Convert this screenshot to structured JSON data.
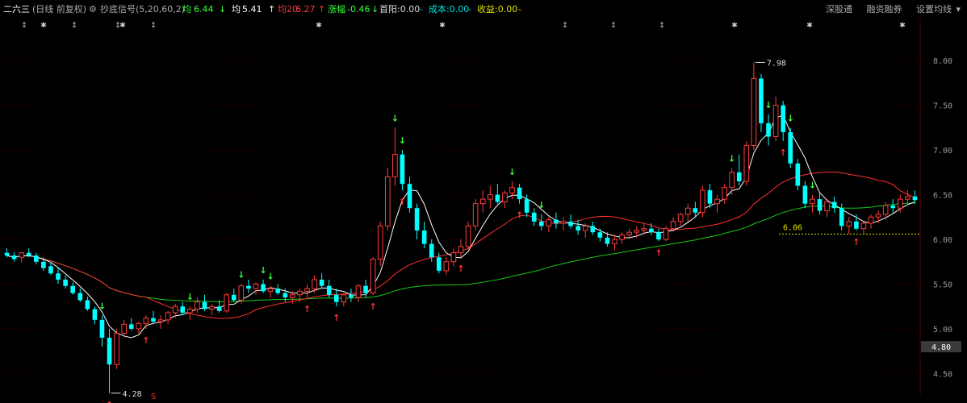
{
  "header": {
    "stock_name": "二六三",
    "period": "(日线 前复权)",
    "indicator": "抄底信号(5,20,60,2)",
    "ma5": {
      "label": "均",
      "value": "6.44",
      "arrow": "↓",
      "color": "#3cff3c"
    },
    "ma_a": {
      "label": "均",
      "value": "5.41",
      "arrow": "↑",
      "color": "#ffffff"
    },
    "ma20": {
      "label": "均20:",
      "value": "6.27",
      "arrow": "↑",
      "color": "#ff3b3b"
    },
    "change": {
      "label": "涨幅",
      "value": "-0.46",
      "arrow": "↓",
      "color": "#3cff3c"
    },
    "first_yang": "首阳:0.00",
    "cost": "成本:0.00",
    "profit": "收益:0.00",
    "dash": "-"
  },
  "toolbar": {
    "shenzhen": "深股通",
    "margin": "融资融券",
    "ma_settings": "设置均线"
  },
  "annotations": {
    "high": "7.98",
    "low": "4.28",
    "level": "6.06",
    "s_mark": "S",
    "last_price": "4.80"
  },
  "colors": {
    "up": "#ff3b3b",
    "down": "#00ffff",
    "ma5": "#ffffff",
    "ma20": "#ff3030",
    "ma60": "#18c818",
    "buy": "#ff3030",
    "sell": "#3cff3c",
    "level": "#e0e000",
    "grid": "#3a0000"
  },
  "chart_data": {
    "type": "candlestick",
    "y_ticks": [
      "8.00",
      "7.50",
      "7.00",
      "6.50",
      "6.00",
      "5.50",
      "5.00",
      "4.50"
    ],
    "y_tick_values": [
      8.0,
      7.5,
      7.0,
      6.5,
      6.0,
      5.5,
      5.0,
      4.5
    ],
    "ylim": [
      4.26,
      8.48
    ],
    "candles": [
      [
        5.85,
        5.9,
        5.8,
        5.82
      ],
      [
        5.82,
        5.86,
        5.75,
        5.78
      ],
      [
        5.8,
        5.86,
        5.74,
        5.85
      ],
      [
        5.85,
        5.9,
        5.8,
        5.82
      ],
      [
        5.82,
        5.85,
        5.72,
        5.75
      ],
      [
        5.75,
        5.8,
        5.65,
        5.68
      ],
      [
        5.7,
        5.75,
        5.6,
        5.62
      ],
      [
        5.62,
        5.68,
        5.5,
        5.55
      ],
      [
        5.55,
        5.6,
        5.45,
        5.48
      ],
      [
        5.48,
        5.52,
        5.38,
        5.4
      ],
      [
        5.4,
        5.45,
        5.3,
        5.32
      ],
      [
        5.32,
        5.36,
        5.2,
        5.22
      ],
      [
        5.22,
        5.25,
        5.05,
        5.1
      ],
      [
        5.1,
        5.15,
        4.8,
        4.9
      ],
      [
        4.9,
        5.0,
        4.28,
        4.6
      ],
      [
        4.6,
        5.0,
        4.55,
        4.95
      ],
      [
        4.95,
        5.1,
        4.9,
        5.05
      ],
      [
        5.05,
        5.12,
        4.98,
        5.0
      ],
      [
        5.0,
        5.08,
        4.95,
        5.06
      ],
      [
        5.06,
        5.15,
        5.0,
        5.12
      ],
      [
        5.12,
        5.2,
        5.05,
        5.08
      ],
      [
        5.08,
        5.15,
        5.0,
        5.1
      ],
      [
        5.1,
        5.2,
        5.05,
        5.18
      ],
      [
        5.18,
        5.28,
        5.12,
        5.25
      ],
      [
        5.25,
        5.3,
        5.15,
        5.18
      ],
      [
        5.18,
        5.25,
        5.1,
        5.22
      ],
      [
        5.22,
        5.35,
        5.18,
        5.3
      ],
      [
        5.3,
        5.38,
        5.2,
        5.22
      ],
      [
        5.22,
        5.28,
        5.15,
        5.25
      ],
      [
        5.25,
        5.32,
        5.18,
        5.2
      ],
      [
        5.2,
        5.4,
        5.18,
        5.38
      ],
      [
        5.38,
        5.45,
        5.3,
        5.32
      ],
      [
        5.32,
        5.5,
        5.28,
        5.48
      ],
      [
        5.48,
        5.55,
        5.4,
        5.45
      ],
      [
        5.45,
        5.52,
        5.38,
        5.5
      ],
      [
        5.5,
        5.55,
        5.4,
        5.42
      ],
      [
        5.42,
        5.48,
        5.35,
        5.45
      ],
      [
        5.45,
        5.5,
        5.38,
        5.4
      ],
      [
        5.4,
        5.45,
        5.3,
        5.35
      ],
      [
        5.35,
        5.42,
        5.28,
        5.38
      ],
      [
        5.38,
        5.45,
        5.3,
        5.42
      ],
      [
        5.42,
        5.5,
        5.35,
        5.45
      ],
      [
        5.45,
        5.6,
        5.4,
        5.55
      ],
      [
        5.55,
        5.62,
        5.45,
        5.48
      ],
      [
        5.48,
        5.55,
        5.35,
        5.38
      ],
      [
        5.38,
        5.45,
        5.25,
        5.3
      ],
      [
        5.3,
        5.4,
        5.25,
        5.38
      ],
      [
        5.38,
        5.45,
        5.3,
        5.35
      ],
      [
        5.35,
        5.5,
        5.3,
        5.48
      ],
      [
        5.48,
        5.55,
        5.35,
        5.4
      ],
      [
        5.4,
        5.8,
        5.38,
        5.78
      ],
      [
        5.78,
        6.2,
        5.7,
        6.15
      ],
      [
        6.15,
        6.8,
        6.1,
        6.7
      ],
      [
        6.7,
        7.25,
        6.6,
        6.95
      ],
      [
        6.95,
        7.0,
        6.55,
        6.62
      ],
      [
        6.62,
        6.7,
        6.3,
        6.35
      ],
      [
        6.35,
        6.4,
        6.0,
        6.1
      ],
      [
        6.1,
        6.2,
        5.9,
        5.95
      ],
      [
        5.95,
        6.0,
        5.75,
        5.8
      ],
      [
        5.8,
        5.85,
        5.62,
        5.65
      ],
      [
        5.65,
        5.8,
        5.6,
        5.75
      ],
      [
        5.75,
        5.9,
        5.7,
        5.85
      ],
      [
        5.85,
        6.0,
        5.8,
        5.92
      ],
      [
        5.92,
        6.2,
        5.88,
        6.15
      ],
      [
        6.15,
        6.45,
        6.1,
        6.4
      ],
      [
        6.4,
        6.55,
        6.3,
        6.45
      ],
      [
        6.45,
        6.6,
        6.35,
        6.5
      ],
      [
        6.5,
        6.62,
        6.4,
        6.42
      ],
      [
        6.42,
        6.55,
        6.35,
        6.52
      ],
      [
        6.52,
        6.65,
        6.45,
        6.58
      ],
      [
        6.58,
        6.62,
        6.4,
        6.45
      ],
      [
        6.45,
        6.5,
        6.25,
        6.3
      ],
      [
        6.3,
        6.35,
        6.15,
        6.2
      ],
      [
        6.2,
        6.28,
        6.1,
        6.15
      ],
      [
        6.15,
        6.25,
        6.08,
        6.22
      ],
      [
        6.22,
        6.3,
        6.12,
        6.18
      ],
      [
        6.18,
        6.25,
        6.1,
        6.2
      ],
      [
        6.2,
        6.28,
        6.12,
        6.15
      ],
      [
        6.15,
        6.22,
        6.05,
        6.1
      ],
      [
        6.1,
        6.18,
        6.02,
        6.15
      ],
      [
        6.15,
        6.2,
        6.05,
        6.08
      ],
      [
        6.08,
        6.12,
        5.98,
        6.02
      ],
      [
        6.02,
        6.08,
        5.92,
        5.95
      ],
      [
        5.95,
        6.05,
        5.88,
        6.0
      ],
      [
        6.0,
        6.08,
        5.95,
        6.05
      ],
      [
        6.05,
        6.12,
        6.0,
        6.08
      ],
      [
        6.08,
        6.15,
        6.02,
        6.1
      ],
      [
        6.1,
        6.18,
        6.05,
        6.12
      ],
      [
        6.12,
        6.18,
        6.05,
        6.08
      ],
      [
        6.08,
        6.12,
        5.98,
        6.0
      ],
      [
        6.0,
        6.15,
        5.98,
        6.12
      ],
      [
        6.12,
        6.25,
        6.08,
        6.2
      ],
      [
        6.2,
        6.3,
        6.15,
        6.28
      ],
      [
        6.28,
        6.4,
        6.2,
        6.35
      ],
      [
        6.35,
        6.42,
        6.25,
        6.3
      ],
      [
        6.3,
        6.6,
        6.25,
        6.55
      ],
      [
        6.55,
        6.62,
        6.35,
        6.4
      ],
      [
        6.4,
        6.5,
        6.3,
        6.45
      ],
      [
        6.45,
        6.62,
        6.4,
        6.58
      ],
      [
        6.58,
        6.8,
        6.5,
        6.75
      ],
      [
        6.75,
        6.95,
        6.6,
        6.65
      ],
      [
        6.65,
        7.1,
        6.6,
        7.05
      ],
      [
        7.05,
        7.98,
        7.0,
        7.8
      ],
      [
        7.8,
        7.85,
        7.2,
        7.3
      ],
      [
        7.3,
        7.4,
        7.05,
        7.15
      ],
      [
        7.15,
        7.6,
        7.1,
        7.5
      ],
      [
        7.5,
        7.55,
        7.1,
        7.2
      ],
      [
        7.2,
        7.25,
        6.8,
        6.85
      ],
      [
        6.85,
        6.9,
        6.55,
        6.6
      ],
      [
        6.6,
        6.65,
        6.35,
        6.4
      ],
      [
        6.4,
        6.5,
        6.3,
        6.45
      ],
      [
        6.45,
        6.52,
        6.28,
        6.32
      ],
      [
        6.32,
        6.45,
        6.25,
        6.42
      ],
      [
        6.42,
        6.48,
        6.3,
        6.35
      ],
      [
        6.35,
        6.4,
        6.1,
        6.15
      ],
      [
        6.15,
        6.25,
        6.06,
        6.2
      ],
      [
        6.2,
        6.28,
        6.1,
        6.12
      ],
      [
        6.12,
        6.2,
        6.06,
        6.18
      ],
      [
        6.18,
        6.28,
        6.12,
        6.25
      ],
      [
        6.25,
        6.32,
        6.18,
        6.28
      ],
      [
        6.28,
        6.42,
        6.22,
        6.38
      ],
      [
        6.38,
        6.45,
        6.3,
        6.35
      ],
      [
        6.35,
        6.5,
        6.3,
        6.45
      ],
      [
        6.45,
        6.55,
        6.38,
        6.48
      ],
      [
        6.48,
        6.55,
        6.4,
        6.44
      ]
    ]
  }
}
